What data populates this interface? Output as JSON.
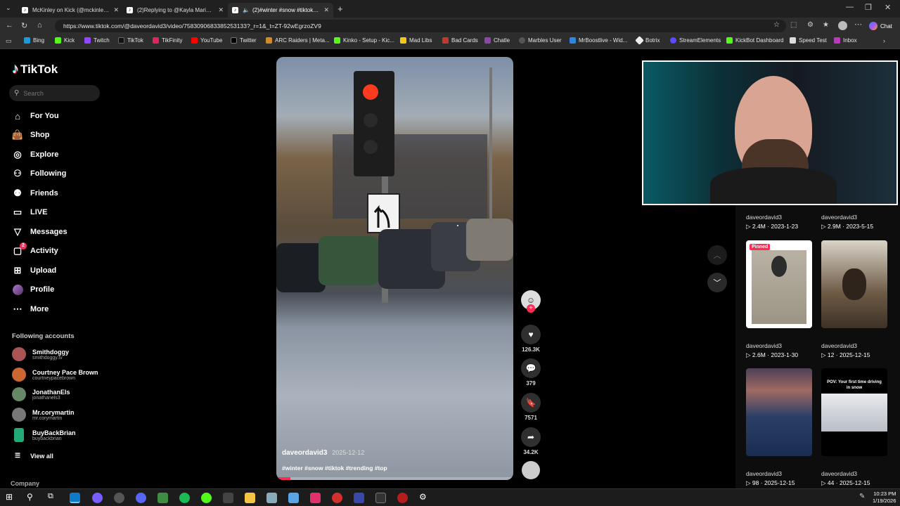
{
  "browser": {
    "tabs": [
      {
        "title": "McKinley on Kick (@mckinley.tv) |",
        "active": false
      },
      {
        "title": "(2)Replying to @Kayla Marie let's",
        "active": false
      },
      {
        "title": "(2)#winter #snow #tiktok #tre",
        "active": true
      }
    ],
    "url": "https://www.tiktok.com/@daveordavid3/video/7583090683385253133?_r=1&_t=ZT-92wEgrzoZV9",
    "chat_label": "Chat",
    "favorites": [
      "Bing",
      "Kick",
      "Twitch",
      "TikTok",
      "TikFinity",
      "YouTube",
      "Twitter",
      "ARC Raiders | Meta...",
      "Kinko - Setup - Kic...",
      "Mad Libs",
      "Bad Cards",
      "Chatle",
      "Marbles User",
      "MrBoostlive - Wid...",
      "Botrix",
      "StreamElements",
      "KickBot Dashboard",
      "Speed Test",
      "Inbox"
    ]
  },
  "sidebar": {
    "logo": "TikTok",
    "search_placeholder": "Search",
    "items": [
      "For You",
      "Shop",
      "Explore",
      "Following",
      "Friends",
      "LIVE",
      "Messages",
      "Activity",
      "Upload",
      "Profile",
      "More"
    ],
    "activity_badge": "2",
    "following_title": "Following accounts",
    "accounts": [
      {
        "name": "Smithdoggy",
        "user": "smithdoggy.tv"
      },
      {
        "name": "Courtney Pace Brown",
        "user": "courtneypacebrown"
      },
      {
        "name": "JonathanEls",
        "user": "jonathanels3"
      },
      {
        "name": "Mr.corymartin",
        "user": "mr.corymartin"
      },
      {
        "name": "BuyBackBrian",
        "user": "buybackbrian"
      }
    ],
    "view_all": "View all",
    "company": "Company"
  },
  "video": {
    "author": "daveordavid3",
    "date": "2025-12-12",
    "caption": "#winter #snow #tiktok #trending #top",
    "likes": "126.3K",
    "comments": "379",
    "saves": "7571",
    "shares": "34.2K"
  },
  "grid": [
    {
      "author": "daveordavid3",
      "views": "2.4M",
      "date": "2023-1-23"
    },
    {
      "author": "daveordavid3",
      "views": "2.9M",
      "date": "2023-5-15"
    },
    {
      "author": "daveordavid3",
      "views": "2.6M",
      "date": "2023-1-30",
      "badge": "Pinned"
    },
    {
      "author": "daveordavid3",
      "views": "12",
      "date": "2025-12-15"
    },
    {
      "author": "daveordavid3",
      "views": "98",
      "date": "2025-12-15"
    },
    {
      "author": "daveordavid3",
      "views": "44",
      "date": "2025-12-15",
      "overlay": "POV: Your first time driving in snow"
    }
  ],
  "clock": {
    "time": "10:23 PM",
    "date": "1/19/2026"
  }
}
